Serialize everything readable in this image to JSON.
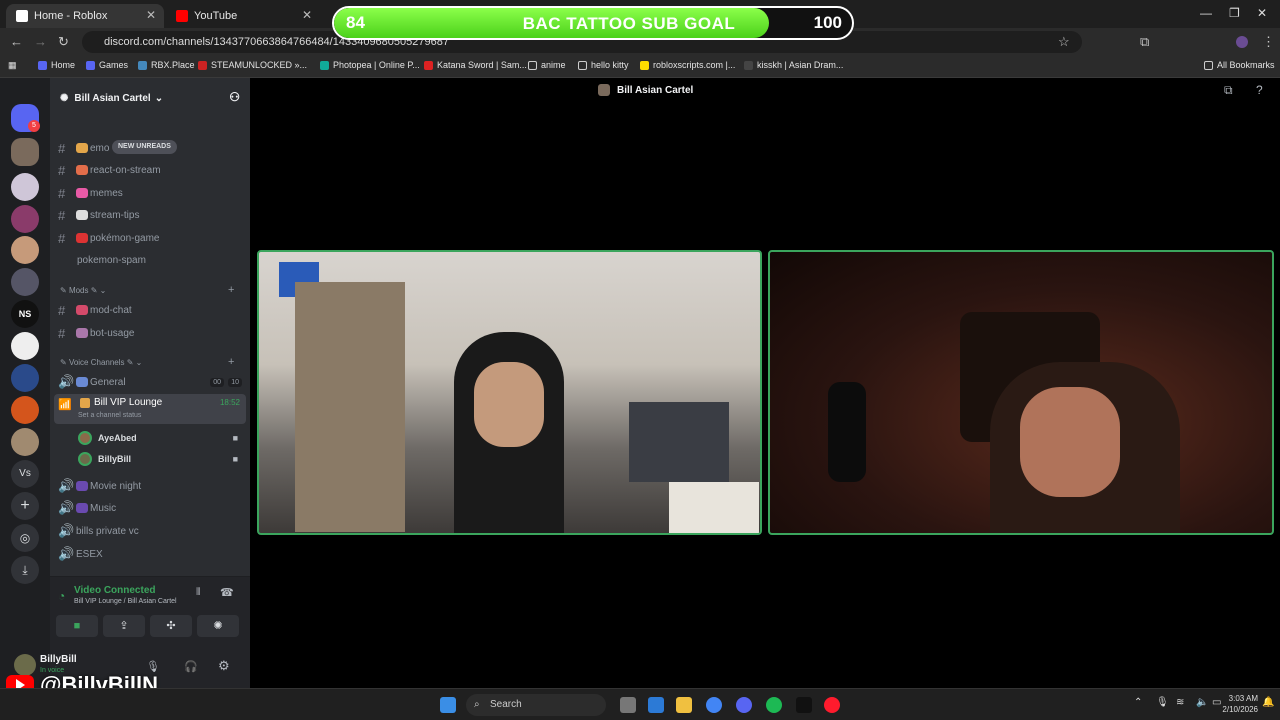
{
  "browser": {
    "tabs": [
      {
        "title": "Home - Roblox"
      },
      {
        "title": "YouTube"
      }
    ],
    "url": "discord.com/channels/1343770663864766484/1433409680505279687",
    "bookmarks": [
      "Home",
      "Games",
      "RBX.Place",
      "STEAMUNLOCKED »...",
      "Photopea | Online P...",
      "Katana Sword | Sam...",
      "anime",
      "hello kitty",
      "robloxscripts.com |...",
      "kisskh | Asian Dram..."
    ],
    "all_bookmarks": "All Bookmarks"
  },
  "sub_goal": {
    "current": 84,
    "title": "BAC TATTOO SUB GOAL",
    "target": 100,
    "progress_fraction": 0.84
  },
  "discord": {
    "server_name": "Bill Asian Cartel",
    "dm_badge": "5",
    "new_unreads": "NEW UNREADS",
    "channels_top": [
      {
        "name": "emo"
      },
      {
        "name": "react-on-stream"
      },
      {
        "name": "memes"
      },
      {
        "name": "stream-tips"
      },
      {
        "name": "pokémon-game"
      },
      {
        "name": "pokemon-spam"
      }
    ],
    "mods_category": "Mods",
    "mod_channels": [
      {
        "name": "mod-chat"
      },
      {
        "name": "bot-usage"
      }
    ],
    "voice_category": "Voice Channels",
    "voice_channels": [
      {
        "name": "General",
        "count_a": "00",
        "count_b": "10"
      },
      {
        "name": "Bill VIP Lounge",
        "timer": "18:52",
        "status": "Set a channel status"
      }
    ],
    "voice_users": [
      {
        "name": "AyeAbed"
      },
      {
        "name": "BillyBill"
      }
    ],
    "voice_channels_after": [
      {
        "name": "Movie night"
      },
      {
        "name": "Music"
      },
      {
        "name": "bills private vc"
      },
      {
        "name": "ESEX"
      }
    ],
    "connection": {
      "status": "Video Connected",
      "detail": "Bill VIP Lounge / Bill Asian Cartel"
    },
    "user": {
      "name": "BillyBill",
      "status": "In voice"
    },
    "header_title": "Bill Asian Cartel"
  },
  "watermark": "@BillyBillN",
  "taskbar": {
    "search": "Search",
    "time": "3:03 AM",
    "date": "2/10/2026"
  },
  "colors": {
    "accent_green": "#3ba55d",
    "goal_green": "#5ee02a",
    "discord_sidebar": "#2b2d31"
  }
}
